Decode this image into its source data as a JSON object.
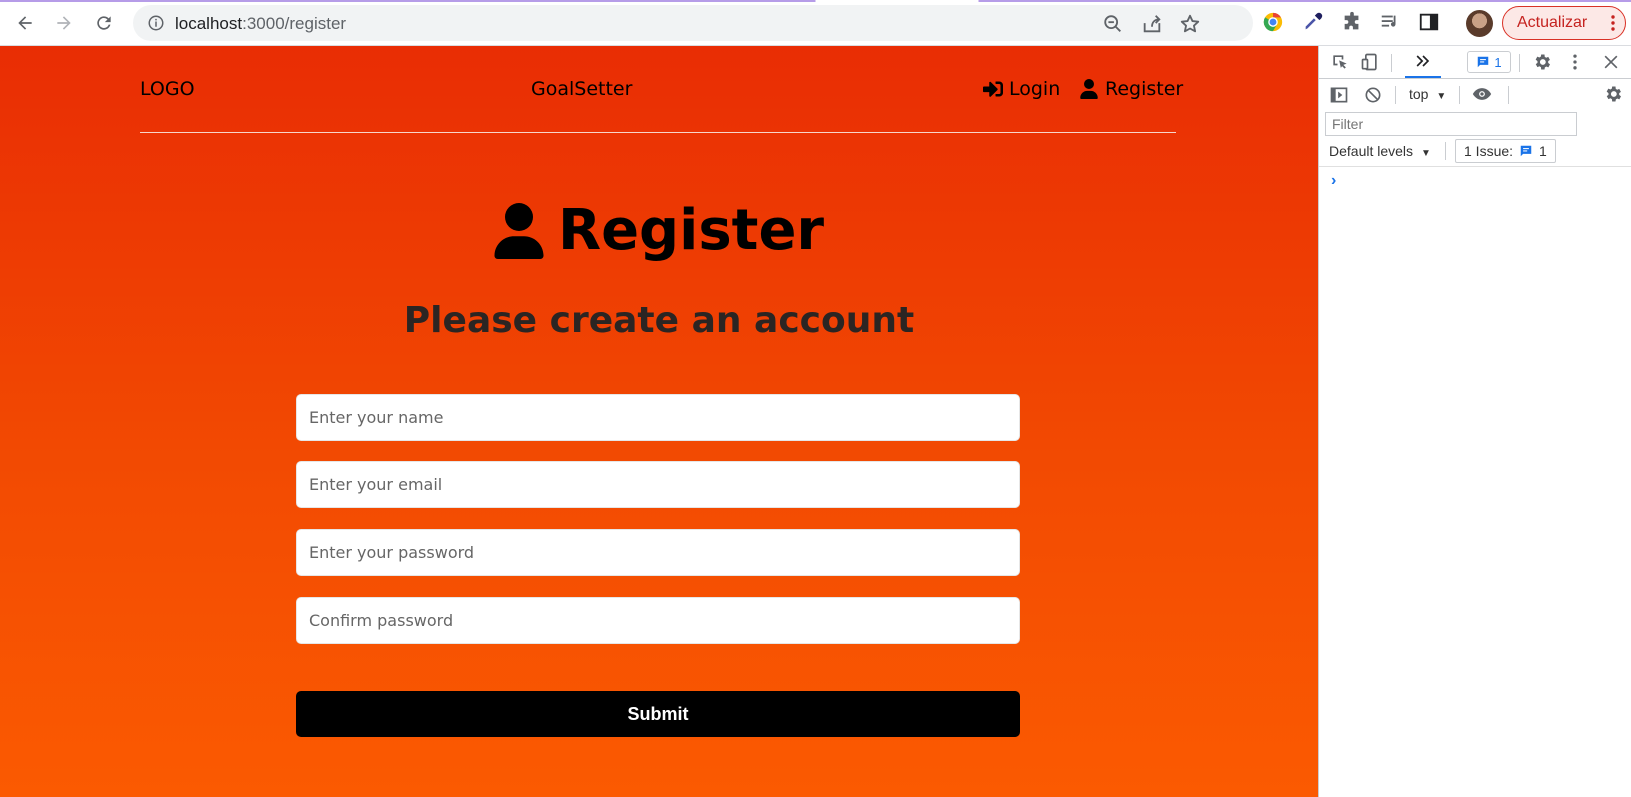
{
  "browser": {
    "url_host": "localhost",
    "url_path": ":3000/register",
    "update_label": "Actualizar"
  },
  "page": {
    "header": {
      "logo": "LOGO",
      "app_name": "GoalSetter",
      "login_label": "Login",
      "register_label": "Register"
    },
    "heading": {
      "title": "Register",
      "subtitle": "Please create an account"
    },
    "form": {
      "name_placeholder": "Enter your name",
      "email_placeholder": "Enter your email",
      "password_placeholder": "Enter your password",
      "confirm_placeholder": "Confirm password",
      "submit_label": "Submit"
    },
    "colors": {
      "gradient_top": "#e92d04",
      "gradient_bottom": "#fb5a01",
      "submit_bg": "#000000"
    }
  },
  "devtools": {
    "issue_badge_count": "1",
    "context": "top",
    "filter_placeholder": "Filter",
    "levels_label": "Default levels",
    "issues_label": "1 Issue:",
    "issues_count": "1",
    "prompt": "›"
  }
}
